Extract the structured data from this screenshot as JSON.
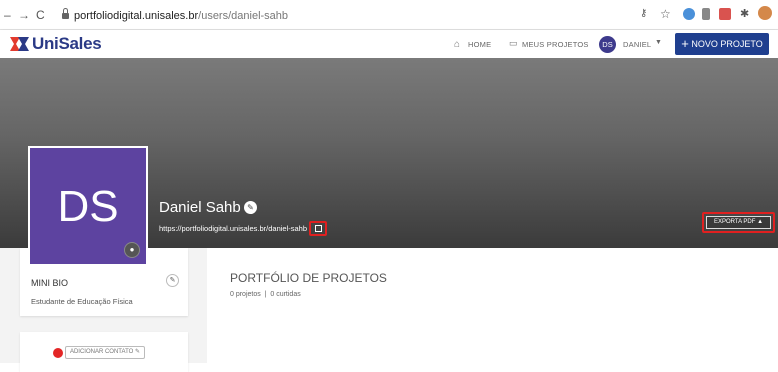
{
  "browser": {
    "url_host": "portfoliodigital.unisales.br",
    "url_path": "/users/daniel-sahb"
  },
  "header": {
    "logo_text": "UniSales",
    "nav_home": "HOME",
    "nav_projects": "MEUS PROJETOS",
    "user_initials": "DS",
    "user_name": "DANIEL",
    "new_project": "NOVO PROJETO"
  },
  "profile": {
    "initials": "DS",
    "name": "Daniel Sahb",
    "url": "https://portfoliodigital.unisales.br/daniel-sahb",
    "export_label": "EXPORTA PDF"
  },
  "bio": {
    "title": "MINI BIO",
    "text": "Estudante de Educação Física"
  },
  "contact": {
    "add_label": "ADICIONAR CONTATO"
  },
  "portfolio": {
    "title": "PORTFÓLIO DE PROJETOS",
    "projects": "0 projetos",
    "likes": "0 curtidas"
  },
  "colors": {
    "brand_blue": "#1f3f8f",
    "avatar_purple": "#5d43a0",
    "highlight_red": "#e02020"
  }
}
